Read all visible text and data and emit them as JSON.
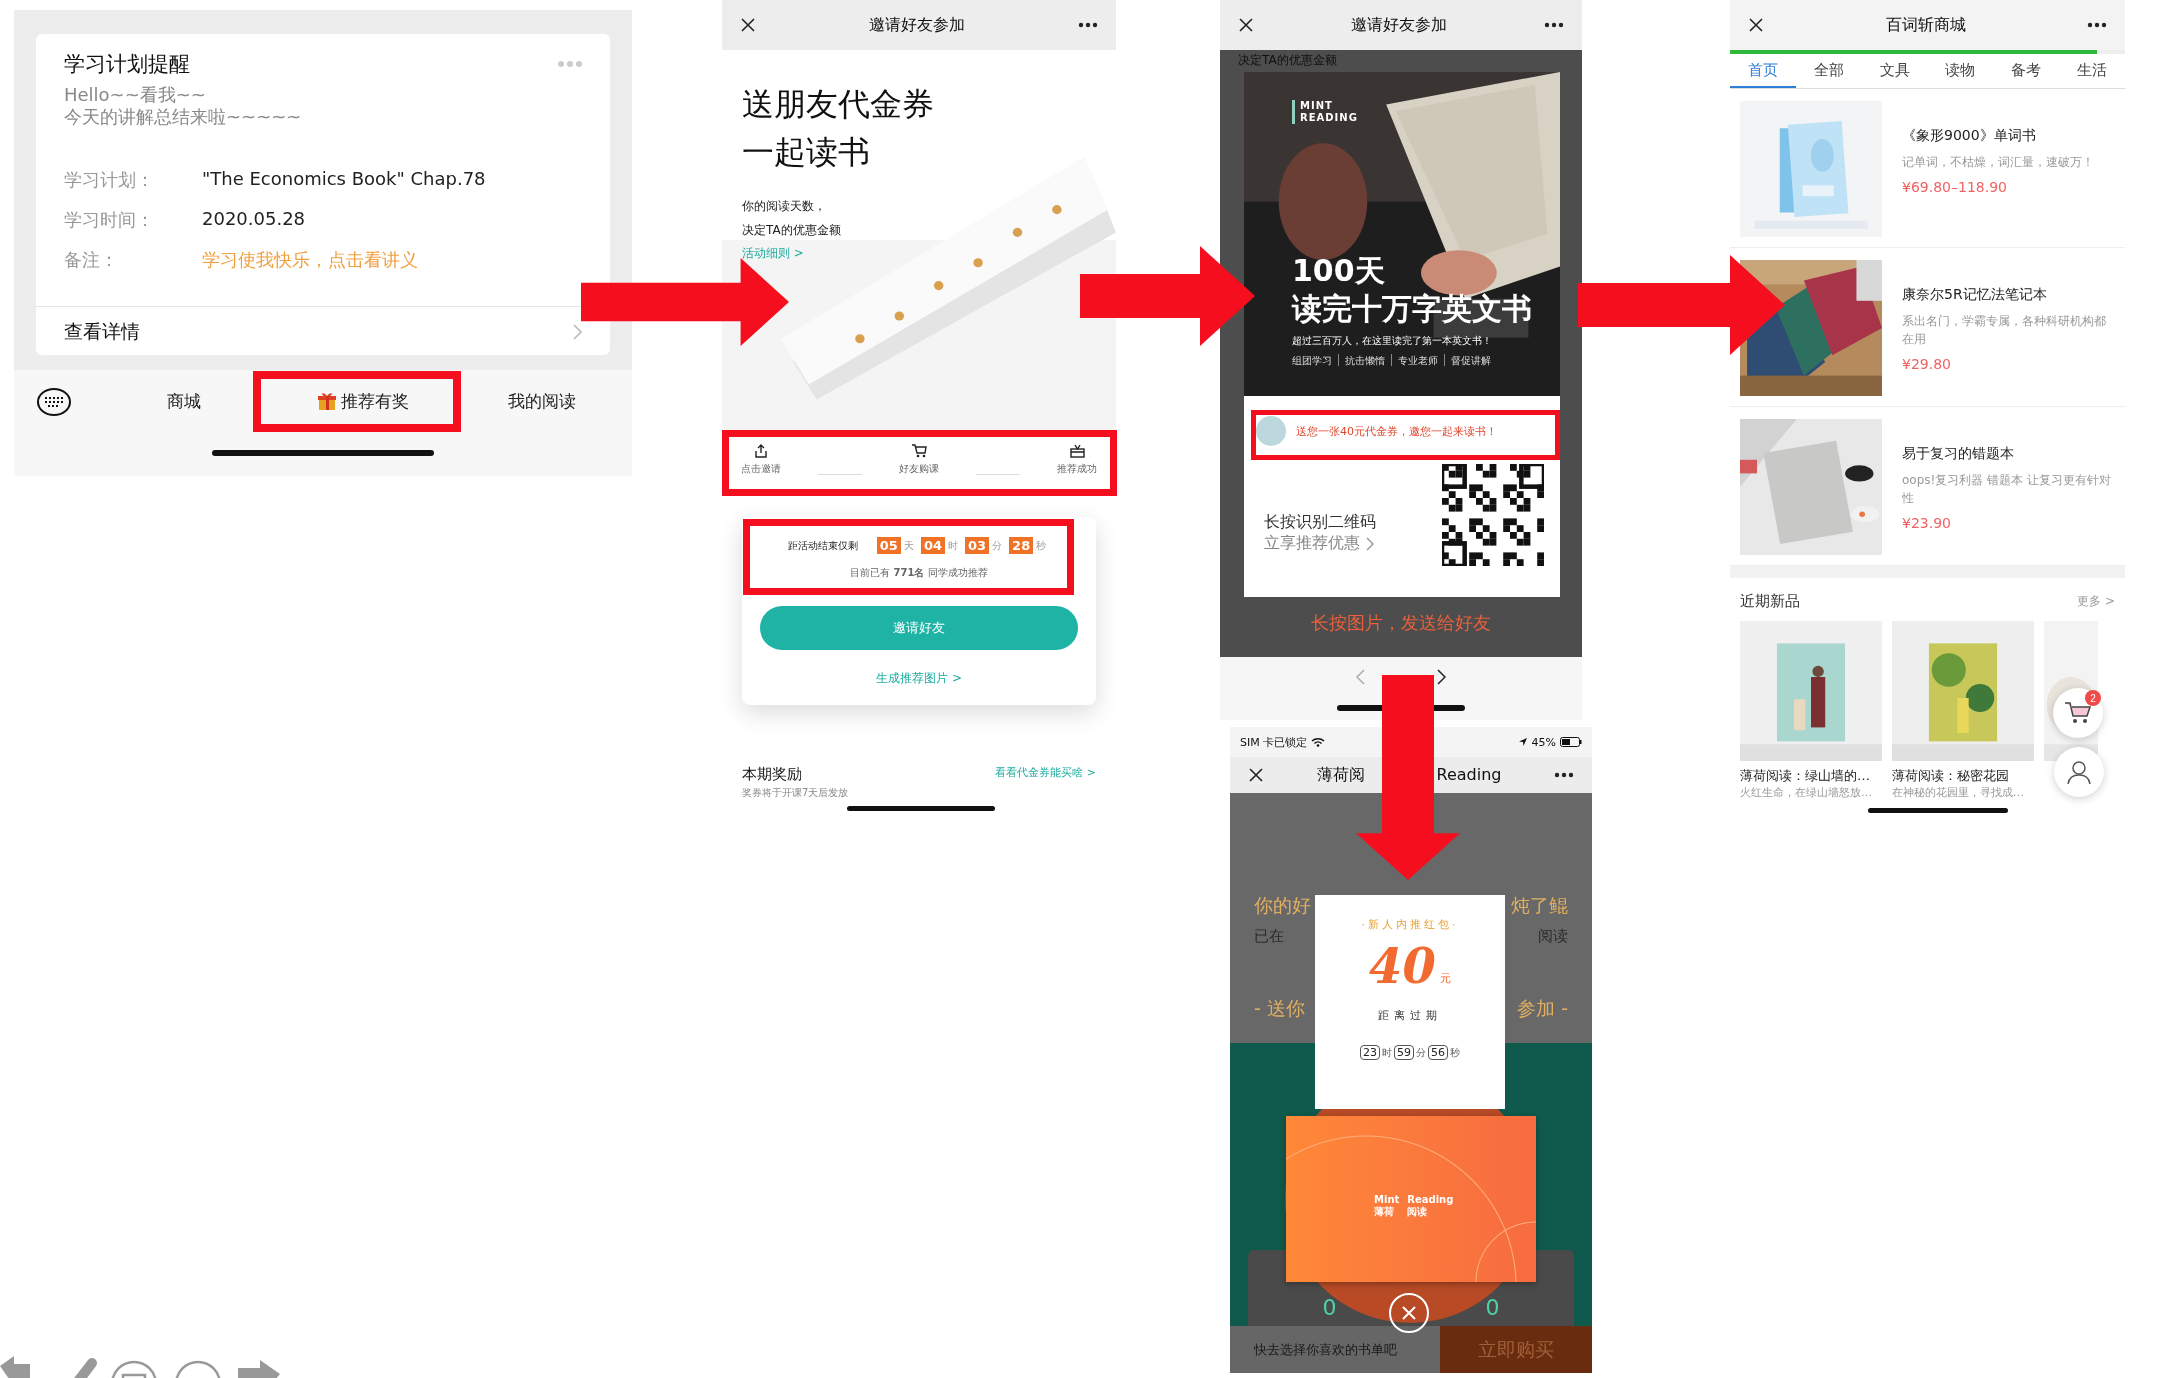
{
  "reminder": {
    "card": {
      "title": "学习计划提醒",
      "greeting": [
        "Hello~~看我~~",
        "今天的讲解总结来啦~~~~~"
      ],
      "fields": [
        {
          "label": "学习计划：",
          "value": "\"The Economics Book\" Chap.78",
          "kind": "text"
        },
        {
          "label": "学习时间：",
          "value": "2020.05.28",
          "kind": "text"
        },
        {
          "label": "备注：",
          "value": "学习使我快乐，点击看讲义",
          "kind": "link"
        }
      ],
      "detail": "查看详情"
    },
    "menu": [
      {
        "label": "商城",
        "kind": "plain"
      },
      {
        "label": "推荐有奖",
        "kind": "gift"
      },
      {
        "label": "我的阅读",
        "kind": "plain"
      }
    ]
  },
  "invite": {
    "title": "邀请好友参加",
    "headline": [
      "送朋友代金券",
      "一起读书"
    ],
    "intro": [
      "你的阅读天数，",
      "决定TA的优惠金额"
    ],
    "rules_link": "活动细则 >",
    "steps": [
      {
        "label": "点击邀请",
        "kind": "share"
      },
      {
        "label": "好友购课",
        "kind": "cart"
      },
      {
        "label": "推荐成功",
        "kind": "gift"
      }
    ],
    "countdown_label": "距活动结束仅剩",
    "countdown": [
      {
        "value": "05",
        "unit": "天"
      },
      {
        "value": "04",
        "unit": "时"
      },
      {
        "value": "03",
        "unit": "分"
      },
      {
        "value": "28",
        "unit": "秒"
      }
    ],
    "count_note": "目前已有 **771名** 同学成功推荐",
    "invite_button": "邀请好友",
    "image_link": "生成推荐图片 >",
    "reward_title": "本期奖励",
    "reward_note": "奖券将于开课7天后发放",
    "reward_link": "看看代金券能买啥 >"
  },
  "poster": {
    "title": "邀请好友参加",
    "backdrop_text": "决定TA的优惠金额",
    "logo": [
      "MINT",
      "READING"
    ],
    "headline": [
      "100天",
      "读完十万字英文书"
    ],
    "tagline": "超过三百万人，在这里读完了第一本英文书！",
    "tags": [
      "组团学习",
      "抗击懒惰",
      "专业老师",
      "督促讲解"
    ],
    "message": "送您一张40元代金券，邀您一起来读书！",
    "qr_lines": [
      "长按识别二维码",
      "立享推荐优惠"
    ],
    "hint": "长按图片，发送给好友"
  },
  "redpacket": {
    "carrier": "SIM 卡已锁定",
    "battery": "45%",
    "title": [
      "薄荷阅",
      "Reading"
    ],
    "backdrop": [
      {
        "left": "你的好",
        "right": "炖了鲲",
        "kind": "title"
      },
      {
        "left": "已在",
        "right": "阅读",
        "kind": "sub"
      },
      {
        "left": "- 送你",
        "right": "参加 -",
        "kind": "title"
      }
    ],
    "stats": [
      "0",
      "0"
    ],
    "footer_text": "快去选择你喜欢的书单吧",
    "buy_button": "立即购买",
    "packet": {
      "title": "·新人内推红包·",
      "amount": "40",
      "currency": "元",
      "expiry_label": "距离过期",
      "countdown": [
        {
          "value": "23",
          "unit": "时"
        },
        {
          "value": "59",
          "unit": "分"
        },
        {
          "value": "56",
          "unit": "秒"
        }
      ],
      "brand": [
        "Mint",
        "薄荷",
        "Reading",
        "阅读"
      ]
    }
  },
  "shop": {
    "title": "百词斩商城",
    "load_progress": {
      "level": 0.93
    },
    "tabs": [
      {
        "label": "首页",
        "selected": true
      },
      {
        "label": "全部",
        "selected": false
      },
      {
        "label": "文具",
        "selected": false
      },
      {
        "label": "读物",
        "selected": false
      },
      {
        "label": "备考",
        "selected": false
      },
      {
        "label": "生活",
        "selected": false
      }
    ],
    "products": [
      {
        "name": "《象形9000》单词书",
        "desc": "记单词，不枯燥，词汇量，速破万！",
        "price": "¥69.80–118.90",
        "kind": "books"
      },
      {
        "name": "康奈尔5R记忆法笔记本",
        "desc": "系出名门，学霸专属，各种科研机构都在用",
        "price": "¥29.80",
        "kind": "notebooks"
      },
      {
        "name": "易于复习的错题本",
        "desc": "oops!复习利器 错题本 让复习更有针对性",
        "price": "¥23.90",
        "kind": "desk"
      }
    ],
    "new_title": "近期新品",
    "more": "更多 >",
    "new_items": [
      {
        "name": "薄荷阅读：绿山墙的…",
        "desc": "火红生命，在绿山墙怒放…",
        "kind": "figures"
      },
      {
        "name": "薄荷阅读：秘密花园",
        "desc": "在神秘的花园里，寻找成…",
        "kind": "garden"
      }
    ],
    "cart_count": "2"
  }
}
